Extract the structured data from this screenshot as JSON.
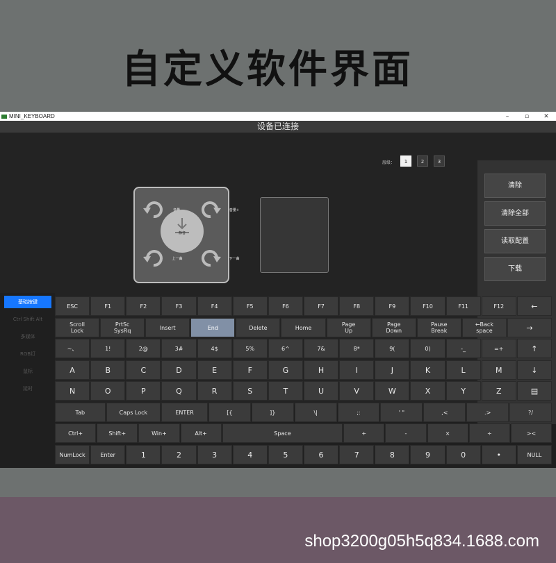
{
  "banner": {
    "title": "自定义软件界面"
  },
  "window": {
    "title": "MINI_KEYBOARD",
    "controls": {
      "minimize": "–",
      "restore": "▫",
      "close": "✕"
    },
    "status": "设备已连接"
  },
  "layers": {
    "label": "层级：",
    "buttons": [
      "1",
      "2",
      "3"
    ],
    "active": "1"
  },
  "knob": {
    "center_label": "静音",
    "center_icon": "download-arrow-icon",
    "top_left_label": "音量-",
    "top_right_label": "音量+",
    "bottom_left_label": "上一曲",
    "bottom_right_label": "下一曲"
  },
  "actions": {
    "clear": "清除",
    "clear_all": "清除全部",
    "read_config": "读取配置",
    "download": "下载"
  },
  "nav": {
    "items": [
      {
        "label": "基础按键",
        "active": true
      },
      {
        "label": "Ctrl Shift Alt",
        "active": false
      },
      {
        "label": "多媒体",
        "active": false
      },
      {
        "label": "RGB灯",
        "active": false
      },
      {
        "label": "鼠标",
        "active": false
      },
      {
        "label": "延时",
        "active": false
      }
    ]
  },
  "keyboard": {
    "rows": [
      [
        "ESC",
        "F1",
        "F2",
        "F3",
        "F4",
        "F5",
        "F6",
        "F7",
        "F8",
        "F9",
        "F10",
        "F11",
        "F12",
        "←"
      ],
      [
        "Scroll\nLock",
        "PrtSc\nSysRq",
        "Insert",
        "End",
        "Delete",
        "Home",
        "Page\nUp",
        "Page\nDown",
        "Pause\nBreak",
        "←Back\nspace",
        "→"
      ],
      [
        "~、",
        "1!",
        "2@",
        "3#",
        "4$",
        "5%",
        "6^",
        "7&",
        "8*",
        "9(",
        "0)",
        "-_",
        "=+",
        "↑"
      ],
      [
        "A",
        "B",
        "C",
        "D",
        "E",
        "F",
        "G",
        "H",
        "I",
        "J",
        "K",
        "L",
        "M",
        "↓"
      ],
      [
        "N",
        "O",
        "P",
        "Q",
        "R",
        "S",
        "T",
        "U",
        "V",
        "W",
        "X",
        "Y",
        "Z",
        "▤"
      ],
      [
        "Tab",
        "Caps Lock",
        "ENTER",
        "[{",
        "]}",
        "\\|",
        ";:",
        "' \"",
        ",<",
        ".>",
        "?/"
      ],
      [
        "Ctrl+",
        "Shift+",
        "Win+",
        "Alt+",
        "Space",
        "+",
        "-",
        "×",
        "÷",
        "><"
      ],
      [
        "NumLock",
        "Enter",
        "1",
        "2",
        "3",
        "4",
        "5",
        "6",
        "7",
        "8",
        "9",
        "0",
        "•",
        "NULL"
      ]
    ],
    "selected_key": "End"
  },
  "footer": {
    "watermark": "shop3200g05h5q834.1688.com"
  }
}
